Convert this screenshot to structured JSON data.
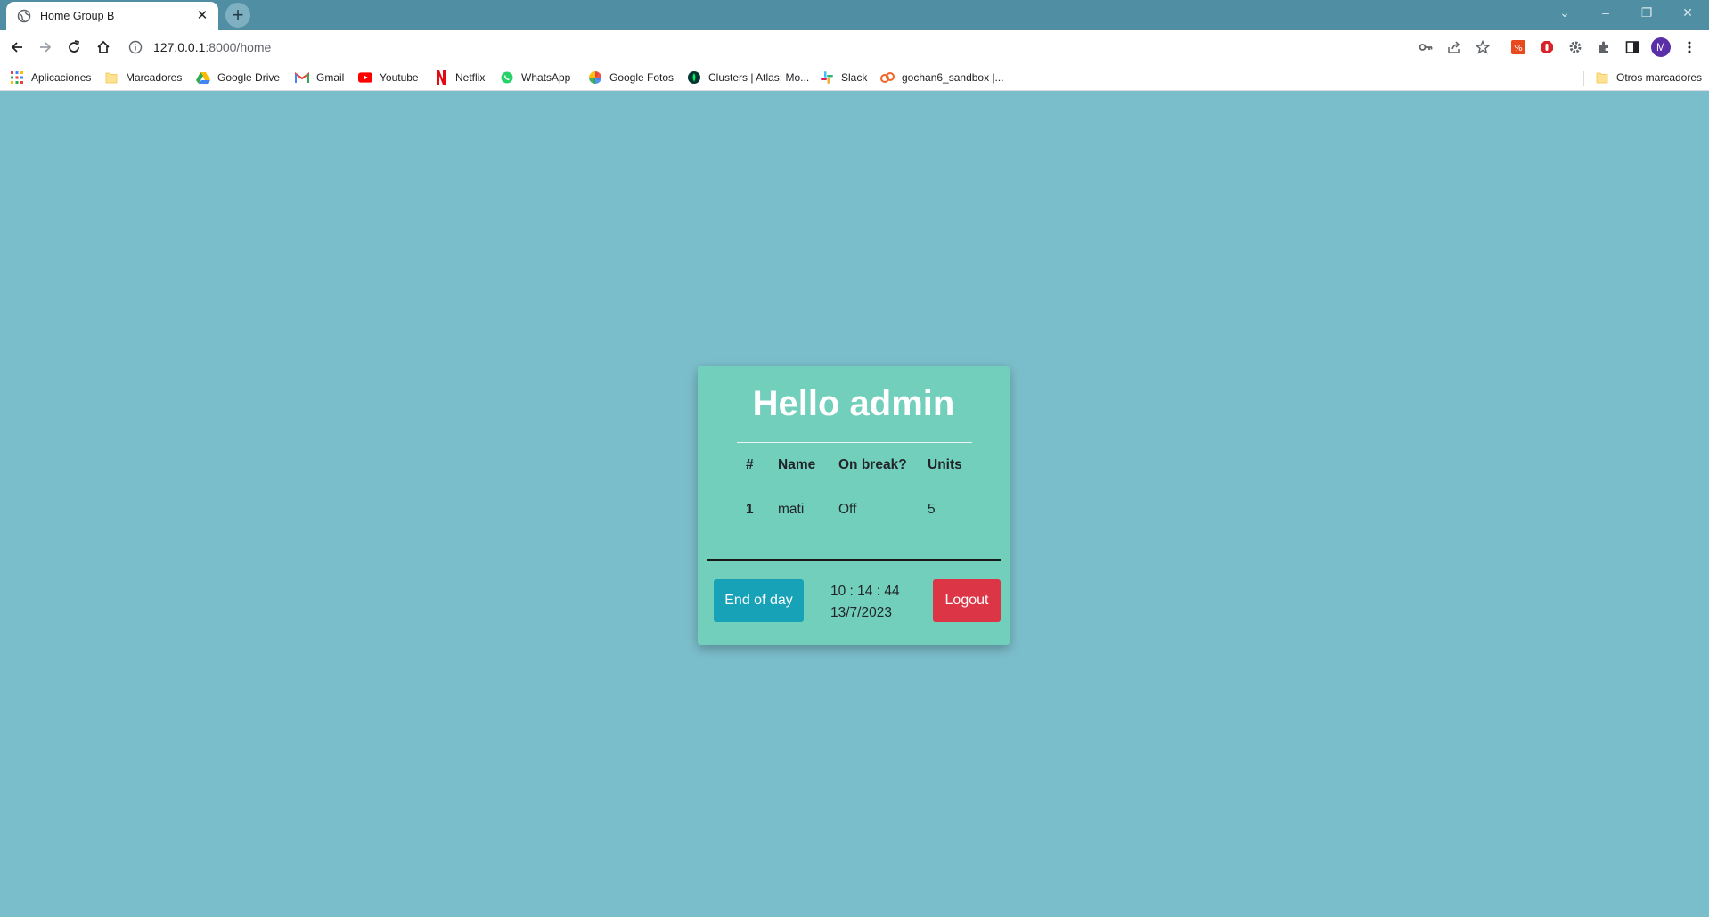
{
  "browser": {
    "tab_title": "Home Group B",
    "url_host": "127.0.0.1",
    "url_path": ":8000/home",
    "new_tab": "+",
    "profile_initial": "M",
    "bookmarks": [
      {
        "label": "Aplicaciones",
        "icon": "apps-grid-icon"
      },
      {
        "label": "Marcadores",
        "icon": "folder-icon"
      },
      {
        "label": "Google Drive",
        "icon": "google-drive-icon"
      },
      {
        "label": "Gmail",
        "icon": "gmail-icon"
      },
      {
        "label": "Youtube",
        "icon": "youtube-icon"
      },
      {
        "label": "Netflix",
        "icon": "netflix-icon"
      },
      {
        "label": "WhatsApp",
        "icon": "whatsapp-icon"
      },
      {
        "label": "Google Fotos",
        "icon": "google-photos-icon"
      },
      {
        "label": "Clusters | Atlas: Mo...",
        "icon": "mongodb-icon"
      },
      {
        "label": "Slack",
        "icon": "slack-icon"
      },
      {
        "label": "gochan6_sandbox |...",
        "icon": "sandbox-icon"
      }
    ],
    "other_bookmarks": "Otros marcadores"
  },
  "page": {
    "greeting": "Hello admin",
    "table": {
      "headers": [
        "#",
        "Name",
        "On break?",
        "Units"
      ],
      "rows": [
        [
          "1",
          "mati",
          "Off",
          "5"
        ]
      ]
    },
    "end_of_day_label": "End of day",
    "logout_label": "Logout",
    "time": "10 : 14 : 44",
    "date": "13/7/2023"
  },
  "colors": {
    "page_bg": "#7bbecb",
    "card_bg": "#72cfbc",
    "end_of_day_btn": "#17a2b8",
    "logout_btn": "#dc3545",
    "tabbar_bg": "#4f8ea3"
  }
}
